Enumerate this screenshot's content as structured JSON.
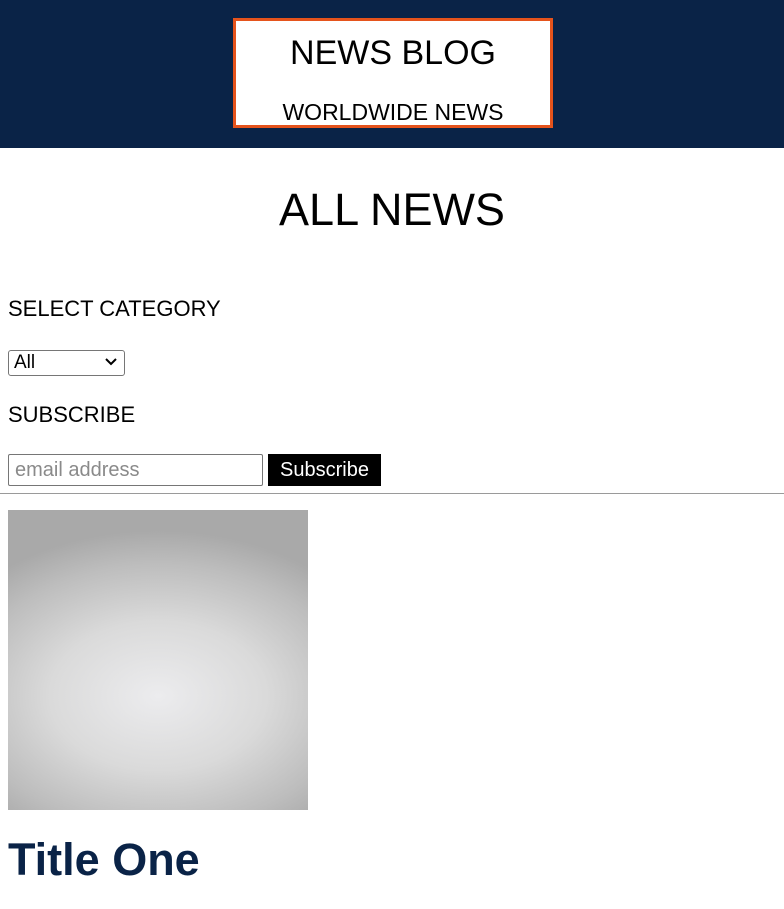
{
  "header": {
    "brand_title": "NEWS BLOG",
    "brand_subtitle": "WORLDWIDE NEWS",
    "background_color": "#0a2347",
    "border_color": "#e5531c"
  },
  "main": {
    "heading": "ALL NEWS",
    "category": {
      "label": "SELECT CATEGORY",
      "selected": "All",
      "icon": "chevron-down-icon"
    },
    "subscribe": {
      "label": "SUBSCRIBE",
      "email_value": "",
      "email_placeholder": "email address",
      "button_label": "Subscribe"
    }
  },
  "posts": [
    {
      "title": "Title One",
      "title_color": "#0a2347"
    }
  ]
}
